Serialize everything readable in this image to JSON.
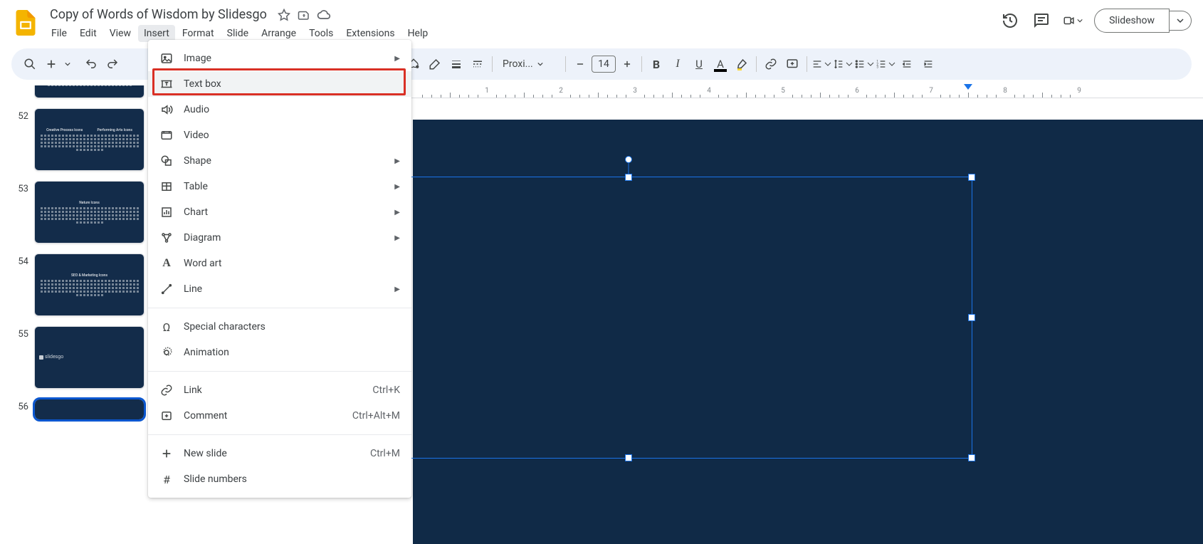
{
  "header": {
    "doc_title": "Copy of Words of Wisdom by Slidesgo",
    "slideshow_label": "Slideshow"
  },
  "menu": {
    "file": "File",
    "edit": "Edit",
    "view": "View",
    "insert": "Insert",
    "format": "Format",
    "slide": "Slide",
    "arrange": "Arrange",
    "tools": "Tools",
    "extensions": "Extensions",
    "help": "Help"
  },
  "toolbar": {
    "font_name": "Proxi...",
    "font_size": "14"
  },
  "insert_menu": {
    "image": "Image",
    "text_box": "Text box",
    "audio": "Audio",
    "video": "Video",
    "shape": "Shape",
    "table": "Table",
    "chart": "Chart",
    "diagram": "Diagram",
    "word_art": "Word art",
    "line": "Line",
    "special_chars": "Special characters",
    "animation": "Animation",
    "link": "Link",
    "link_sc": "Ctrl+K",
    "comment": "Comment",
    "comment_sc": "Ctrl+Alt+M",
    "new_slide": "New slide",
    "new_slide_sc": "Ctrl+M",
    "slide_numbers": "Slide numbers"
  },
  "ruler": {
    "ticks": [
      "1",
      "2",
      "3",
      "4",
      "5",
      "6",
      "7",
      "8",
      "9"
    ]
  },
  "thumbs": [
    {
      "num": "",
      "title_a": "",
      "title_b": "",
      "partial": true
    },
    {
      "num": "52",
      "title_a": "Creative Process Icons",
      "title_b": "Performing Arts Icons"
    },
    {
      "num": "53",
      "title_a": "Nature Icons",
      "title_b": ""
    },
    {
      "num": "54",
      "title_a": "SEO & Marketing Icons",
      "title_b": ""
    },
    {
      "num": "55",
      "title_a": "",
      "title_b": "",
      "logo": "slidesgo"
    },
    {
      "num": "56",
      "title_a": "",
      "title_b": "",
      "selected": true,
      "cut": true
    }
  ]
}
